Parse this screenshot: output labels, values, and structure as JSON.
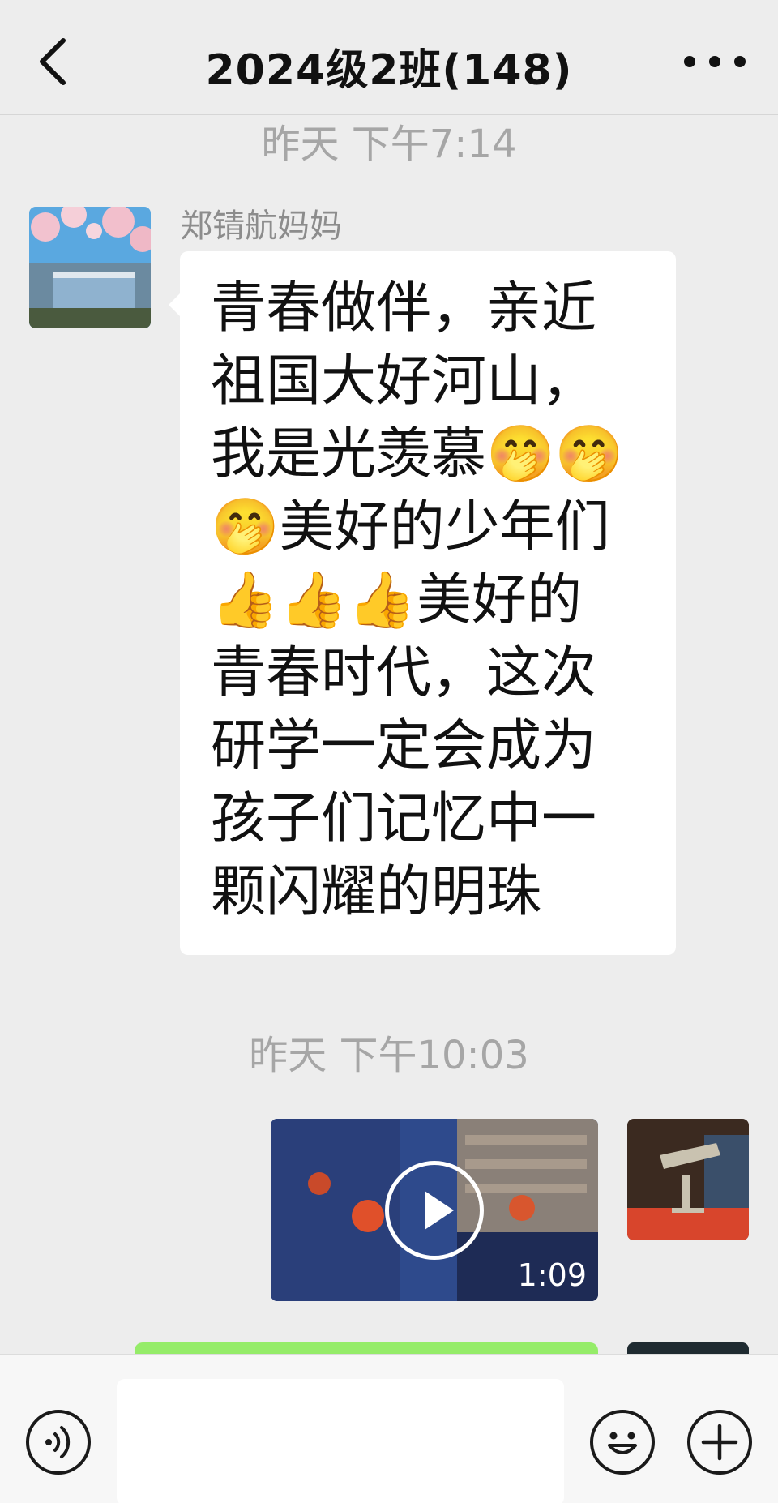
{
  "header": {
    "title": "2024级2班(148)"
  },
  "timestamps": [
    "昨天 下午7:14",
    "昨天 下午10:03"
  ],
  "messages": [
    {
      "sender": "郑锖航妈妈",
      "text": "青春做伴，亲近\n祖国大好河山，\n我是光羡慕🤭🤭\n🤭美好的少年们\n👍👍👍美好的\n青春时代，这次\n研学一定会成为\n孩子们记忆中一\n颗闪耀的明珠"
    }
  ],
  "video": {
    "duration": "1:09"
  },
  "colors": {
    "background": "#ededed",
    "bubble_self": "#95ec69",
    "bubble_other": "#ffffff",
    "timestamp": "#a6a6a6"
  },
  "icons": {
    "back": "chevron-left-icon",
    "more": "more-dots-icon",
    "voice": "voice-icon",
    "emoji": "emoji-icon",
    "plus": "plus-icon",
    "play": "play-icon"
  }
}
